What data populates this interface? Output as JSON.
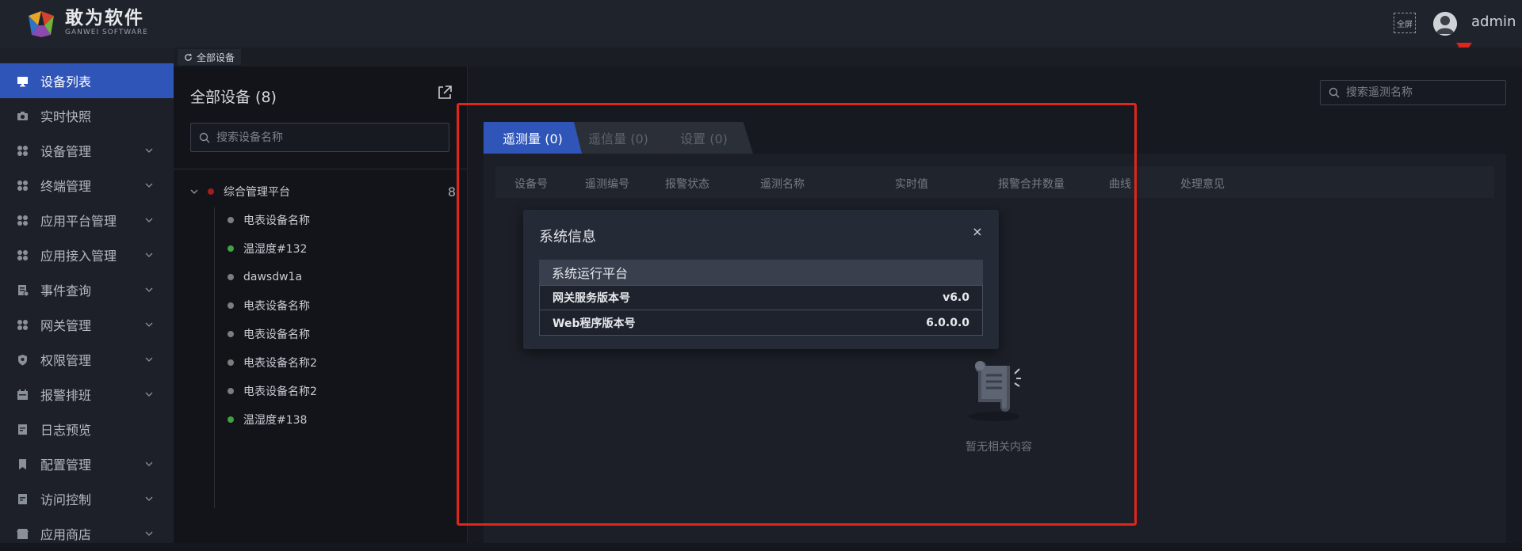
{
  "header": {
    "brand_name": "敢为软件",
    "brand_sub": "GANWEI SOFTWARE",
    "fullscreen_label": "全屏",
    "username": "admin"
  },
  "sidebar": {
    "items": [
      {
        "label": "设备列表",
        "icon": "monitor-icon",
        "has_children": false
      },
      {
        "label": "实时快照",
        "icon": "camera-icon",
        "has_children": false
      },
      {
        "label": "设备管理",
        "icon": "grid-icon",
        "has_children": true
      },
      {
        "label": "终端管理",
        "icon": "grid-icon",
        "has_children": true
      },
      {
        "label": "应用平台管理",
        "icon": "grid-icon",
        "has_children": true
      },
      {
        "label": "应用接入管理",
        "icon": "grid-icon",
        "has_children": true
      },
      {
        "label": "事件查询",
        "icon": "document-icon",
        "has_children": true
      },
      {
        "label": "网关管理",
        "icon": "grid-icon",
        "has_children": true
      },
      {
        "label": "权限管理",
        "icon": "shield-icon",
        "has_children": true
      },
      {
        "label": "报警排班",
        "icon": "calendar-icon",
        "has_children": true
      },
      {
        "label": "日志预览",
        "icon": "log-icon",
        "has_children": false
      },
      {
        "label": "配置管理",
        "icon": "bookmark-icon",
        "has_children": true
      },
      {
        "label": "访问控制",
        "icon": "log-icon",
        "has_children": true
      },
      {
        "label": "应用商店",
        "icon": "store-icon",
        "has_children": true
      }
    ]
  },
  "tabstrip": {
    "tab_label": "全部设备"
  },
  "device_panel": {
    "title": "全部设备 (8)",
    "search_placeholder": "搜索设备名称",
    "root": {
      "label": "综合管理平台",
      "count": "8"
    },
    "leaves": [
      {
        "label": "电表设备名称",
        "status": "offline"
      },
      {
        "label": "温湿度#132",
        "status": "online"
      },
      {
        "label": "dawsdw1a",
        "status": "offline"
      },
      {
        "label": "电表设备名称",
        "status": "offline"
      },
      {
        "label": "电表设备名称",
        "status": "offline"
      },
      {
        "label": "电表设备名称2",
        "status": "offline"
      },
      {
        "label": "电表设备名称2",
        "status": "offline"
      },
      {
        "label": "温湿度#138",
        "status": "online"
      }
    ]
  },
  "main": {
    "search_placeholder": "搜索遥测名称",
    "tabs": [
      "遥测量 (0)",
      "遥信量 (0)",
      "设置 (0)"
    ],
    "columns": [
      "设备号",
      "遥测编号",
      "报警状态",
      "遥测名称",
      "实时值",
      "报警合并数量",
      "曲线",
      "处理意见"
    ],
    "empty_text": "暂无相关内容"
  },
  "dialog": {
    "title": "系统信息",
    "close_symbol": "×",
    "section": "系统运行平台",
    "rows": [
      {
        "label": "网关服务版本号",
        "value": "v6.0"
      },
      {
        "label": "Web程序版本号",
        "value": "6.0.0.0"
      }
    ]
  },
  "colors": {
    "accent": "#2f55b8",
    "online": "#3fa33f",
    "offline": "#7d7d7d",
    "root_dot": "#a61c1c",
    "annotation": "#e0251b"
  }
}
